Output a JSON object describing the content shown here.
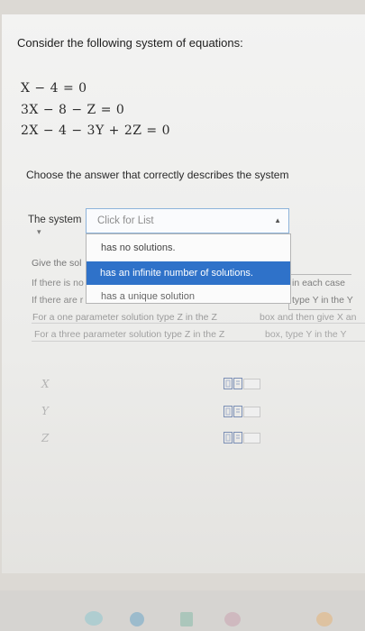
{
  "question": {
    "prompt": "Consider the following system of equations:",
    "equations": [
      "X − 4 = 0",
      "3X − 8 − Z = 0",
      "2X − 4 − 3Y + 2Z = 0"
    ],
    "instruction": "Choose the answer that correctly describes the system"
  },
  "select": {
    "label": "The system",
    "placeholder": "Click for List",
    "options": [
      "has no solutions.",
      "has an infinite number of solutions.",
      "has a unique solution"
    ],
    "highlighted_index": 1
  },
  "background_text": {
    "line1": "Give the sol",
    "line2": "If there is no",
    "line3": "If there are r",
    "line4": "For a one parameter solution type Z in the Z",
    "line5": "For a three parameter solution type Z in the Z",
    "right1": "in each case",
    "right2": "type Y in the Y",
    "right3": "box and then give X an",
    "right4": "box, type Y in the Y"
  },
  "variables": [
    "X",
    "Y",
    "Z"
  ],
  "colors": {
    "highlight": "#2f72c9",
    "select_border": "#8db3da"
  }
}
